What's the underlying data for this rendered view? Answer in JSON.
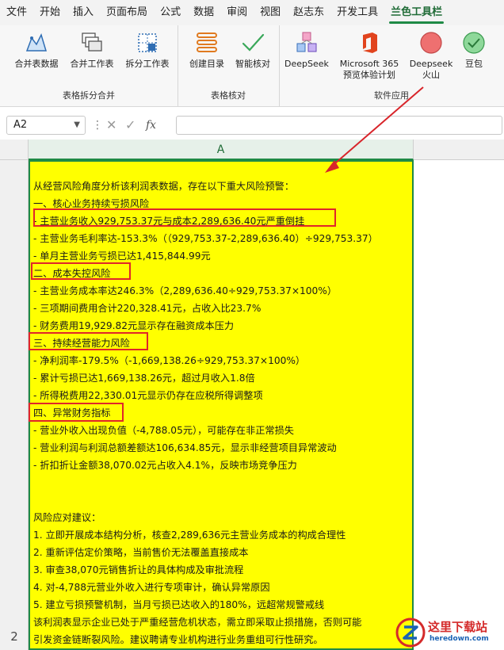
{
  "menu": {
    "items": [
      "文件",
      "开始",
      "插入",
      "页面布局",
      "公式",
      "数据",
      "审阅",
      "视图",
      "赵志东",
      "开发工具",
      "兰色工具栏"
    ],
    "active_index": 10
  },
  "ribbon": {
    "groups": [
      {
        "label": "表格拆分合并",
        "buttons": [
          "合并表数据",
          "合并工作表",
          "拆分工作表"
        ]
      },
      {
        "label": "表格核对",
        "buttons": [
          "创建目录",
          "智能核对"
        ]
      },
      {
        "label": "软件应用",
        "buttons": [
          "DeepSeek",
          "Microsoft 365",
          "预览体验计划",
          "Deepseek",
          "火山",
          "豆包"
        ]
      }
    ]
  },
  "formula_bar": {
    "name_box": "A2",
    "fx": "fx",
    "content": ""
  },
  "grid": {
    "column_header": "A",
    "row_header": "2"
  },
  "cell": {
    "lines": [
      "从经营风险角度分析该利润表数据，存在以下重大风险预警：",
      "一、核心业务持续亏损风险",
      "- 主营业务收入929,753.37元与成本2,289,636.40元严重倒挂",
      "- 主营业务毛利率达-153.3%（（929,753.37-2,289,636.40）÷929,753.37）",
      "- 单月主营业务亏损已达1,415,844.99元",
      "二、成本失控风险",
      "- 主营业务成本率达246.3%（2,289,636.40÷929,753.37×100%）",
      "- 三项期间费用合计220,328.41元，占收入比23.7%",
      "- 财务费用19,929.82元显示存在融资成本压力",
      "三、持续经营能力风险",
      "- 净利润率-179.5%（-1,669,138.26÷929,753.37×100%）",
      "- 累计亏损已达1,669,138.26元，超过月收入1.8倍",
      "- 所得税费用22,330.01元显示仍存在应税所得调整项",
      "四、异常财务指标",
      "- 营业外收入出现负值（-4,788.05元），可能存在非正常损失",
      "- 营业利润与利润总额差额达106,634.85元，显示非经营项目异常波动",
      "- 折扣折让金额38,070.02元占收入4.1%，反映市场竞争压力",
      "",
      "",
      "风险应对建议：",
      "1. 立即开展成本结构分析，核查2,289,636元主营业务成本的构成合理性",
      "2. 重新评估定价策略，当前售价无法覆盖直接成本",
      "3. 审查38,070元销售折让的具体构成及审批流程",
      "4. 对-4,788元营业外收入进行专项审计，确认异常原因",
      "5. 建立亏损预警机制，当月亏损已达收入的180%，远超常规警戒线",
      "该利润表显示企业已处于严重经营危机状态，需立即采取止损措施，否则可能",
      "引发资金链断裂风险。建议聘请专业机构进行业务重组可行性研究。"
    ]
  },
  "watermark": {
    "title": "这里下载站",
    "subtitle": "heredown.com"
  },
  "colors": {
    "accent_green": "#1f8a46",
    "cell_fill": "#ffff00",
    "highlight_red": "#e0262a"
  }
}
